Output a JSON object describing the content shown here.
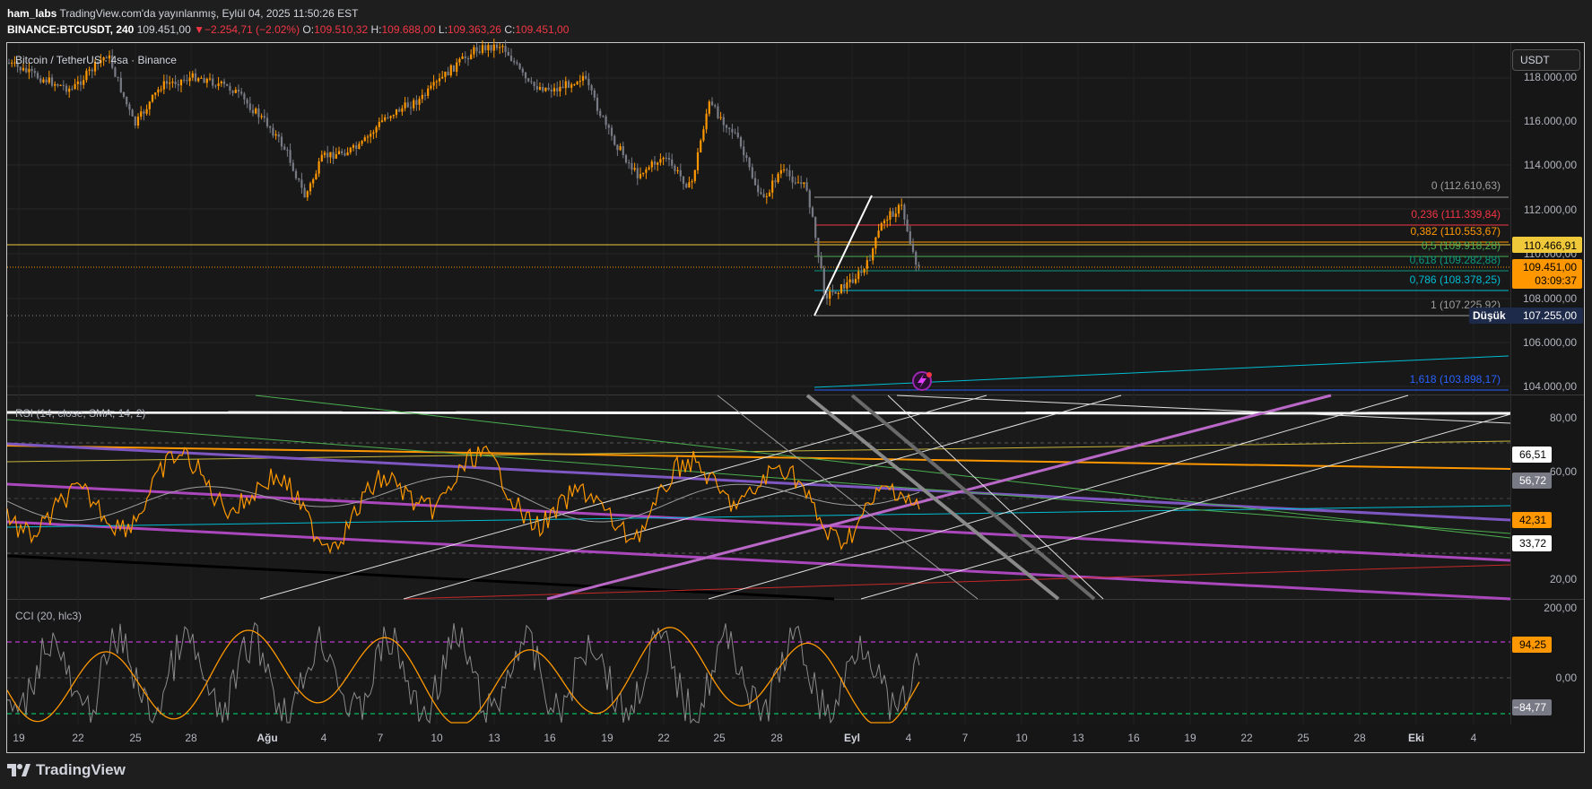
{
  "header": {
    "author": "ham_labs",
    "published": "TradingView.com'da yayınlanmış, Eylül 04, 2025 11:50:26 EST",
    "symbol": "BINANCE:BTCUSDT, 240",
    "last": "109.451,00",
    "change": "−2.254,71 (−2.02%)",
    "o_label": "O:",
    "o": "109.510,32",
    "h_label": "H:",
    "h": "109.688,00",
    "l_label": "L:",
    "l": "109.363,26",
    "c_label": "C:",
    "c": "109.451,00"
  },
  "price_pane": {
    "title": "Bitcoin / TetherUS · 4sa · Binance",
    "currency_button": "USDT",
    "axis_labels": [
      "118.000,00",
      "116.000,00",
      "114.000,00",
      "112.000,00",
      "110.000,00",
      "108.000,00",
      "106.000,00",
      "104.000,00"
    ],
    "fib_levels": [
      {
        "label": "0 (112.610,63)",
        "color": "#9e9e9e"
      },
      {
        "label": "0,236 (111.339,84)",
        "color": "#f23645"
      },
      {
        "label": "0,382 (110.553,67)",
        "color": "#ff9800"
      },
      {
        "label": "0,5 (109.918,28)",
        "color": "#4caf50"
      },
      {
        "label": "0,618 (109.282,88)",
        "color": "#089981"
      },
      {
        "label": "0,786 (108.378,25)",
        "color": "#00bcd4"
      },
      {
        "label": "1 (107.225,92)",
        "color": "#9e9e9e"
      },
      {
        "label": "1,618 (103.898,17)",
        "color": "#2962ff"
      }
    ],
    "badge_level": "110.466,91",
    "badge_price": "109.451,00",
    "badge_countdown": "03:09:37",
    "low_label": "Düşük",
    "low_value": "107.255,00"
  },
  "rsi_pane": {
    "title": "RSI (14, close, SMA, 14, 2)",
    "axis_labels": [
      "80,00",
      "60,00",
      "20,00"
    ],
    "badges": [
      "66,51",
      "56,72",
      "42,31",
      "33,72"
    ]
  },
  "cci_pane": {
    "title": "CCI (20, hlc3)",
    "axis_labels": [
      "200,00",
      "0,00"
    ],
    "badges": [
      "94,25",
      "−84,77"
    ]
  },
  "time_axis": [
    "19",
    "22",
    "25",
    "28",
    "Ağu",
    "4",
    "7",
    "10",
    "13",
    "16",
    "19",
    "22",
    "25",
    "28",
    "Eyl",
    "4",
    "7",
    "10",
    "13",
    "16",
    "19",
    "22",
    "25",
    "28",
    "Eki",
    "4"
  ],
  "footer": {
    "brand": "TradingView"
  },
  "colors": {
    "accent": "#ff9800",
    "up": "#ff9800",
    "down": "#787b86",
    "background": "#161616"
  }
}
